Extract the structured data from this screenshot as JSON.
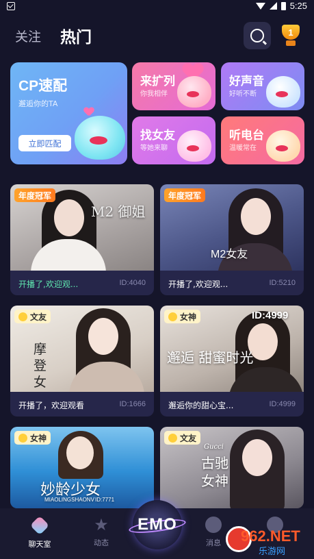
{
  "status_bar": {
    "time": "5:25"
  },
  "header": {
    "tab_follow": "关注",
    "tab_hot": "热门"
  },
  "cp_card": {
    "title_latin": "CP",
    "title_cn": "速配",
    "subtitle": "邂逅你的TA",
    "button": "立即匹配"
  },
  "mini_cards": [
    {
      "title": "来扩列",
      "subtitle": "你我相伴"
    },
    {
      "title": "好声音",
      "subtitle": "好听不断"
    },
    {
      "title": "找女友",
      "subtitle": "等她来聊"
    },
    {
      "title": "听电台",
      "subtitle": "温暖常在"
    }
  ],
  "rooms": [
    {
      "badge": "年度冠军",
      "overlay": "M2 御姐",
      "caption": "开播了,欢迎观...",
      "id": "ID:4040"
    },
    {
      "badge": "年度冠军",
      "overlay": "M2女友",
      "caption": "开播了,欢迎观...",
      "id": "ID:5210"
    },
    {
      "badge": "文友",
      "overlay": "摩登 女神",
      "caption": "开播了，欢迎观看",
      "id": "ID:1666"
    },
    {
      "badge": "女神",
      "overlay": "邂逅 甜蜜时光",
      "overlay_id": "ID:4999",
      "caption": "邂逅你的甜心宝...",
      "id": "ID:4999"
    },
    {
      "badge": "女神",
      "overlay": "妙龄少女",
      "overlay_sub": "MIAOLINGSHAONV",
      "overlay_id": "ID:7771"
    },
    {
      "badge": "文友",
      "overlay": "古驰 女神",
      "overlay_sub": "Gucci"
    }
  ],
  "bottom_nav": {
    "chat": "聊天室",
    "dynamic": "动态",
    "center": "EMO",
    "message": "消息"
  },
  "watermark": {
    "number": "962.NET",
    "site": "乐游网"
  },
  "colors": {
    "background": "#15152a",
    "card": "#26264a",
    "accent_green": "#60e8b0",
    "badge_orange": "#ff7a1f"
  }
}
